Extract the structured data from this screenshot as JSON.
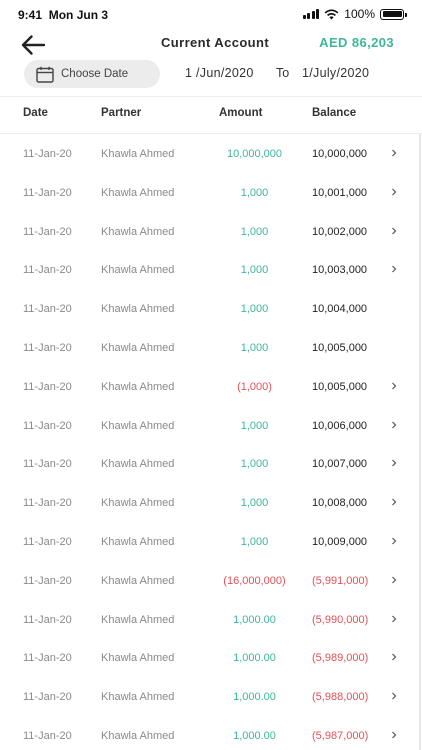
{
  "status_bar": {
    "time": "9:41",
    "date": "Mon Jun 3",
    "battery": "100%"
  },
  "header": {
    "title": "Current Account",
    "balance": "AED 86,203"
  },
  "filter": {
    "choose_label": "Choose Date",
    "from": "1 /Jun/2020",
    "to_word": "To",
    "to": "1/July/2020"
  },
  "table": {
    "columns": [
      "Date",
      "Partner",
      "Amount",
      "Balance"
    ],
    "rows": [
      {
        "date": "11-Jan-20",
        "partner": "Khawla Ahmed",
        "amount": "10,000,000",
        "amount_type": "pos",
        "balance": "10,000,000",
        "balance_type": "normal",
        "chevron": true
      },
      {
        "date": "11-Jan-20",
        "partner": "Khawla Ahmed",
        "amount": "1,000",
        "amount_type": "pos",
        "balance": "10,001,000",
        "balance_type": "normal",
        "chevron": true
      },
      {
        "date": "11-Jan-20",
        "partner": "Khawla Ahmed",
        "amount": "1,000",
        "amount_type": "pos",
        "balance": "10,002,000",
        "balance_type": "normal",
        "chevron": true
      },
      {
        "date": "11-Jan-20",
        "partner": "Khawla Ahmed",
        "amount": "1,000",
        "amount_type": "pos",
        "balance": "10,003,000",
        "balance_type": "normal",
        "chevron": true
      },
      {
        "date": "11-Jan-20",
        "partner": "Khawla Ahmed",
        "amount": "1,000",
        "amount_type": "pos",
        "balance": "10,004,000",
        "balance_type": "normal",
        "chevron": false
      },
      {
        "date": "11-Jan-20",
        "partner": "Khawla Ahmed",
        "amount": "1,000",
        "amount_type": "pos",
        "balance": "10,005,000",
        "balance_type": "normal",
        "chevron": false
      },
      {
        "date": "11-Jan-20",
        "partner": "Khawla Ahmed",
        "amount": "(1,000)",
        "amount_type": "neg",
        "balance": "10,005,000",
        "balance_type": "normal",
        "chevron": true
      },
      {
        "date": "11-Jan-20",
        "partner": "Khawla Ahmed",
        "amount": "1,000",
        "amount_type": "pos",
        "balance": "10,006,000",
        "balance_type": "normal",
        "chevron": true
      },
      {
        "date": "11-Jan-20",
        "partner": "Khawla Ahmed",
        "amount": "1,000",
        "amount_type": "pos",
        "balance": "10,007,000",
        "balance_type": "normal",
        "chevron": true
      },
      {
        "date": "11-Jan-20",
        "partner": "Khawla Ahmed",
        "amount": "1,000",
        "amount_type": "pos",
        "balance": "10,008,000",
        "balance_type": "normal",
        "chevron": true
      },
      {
        "date": "11-Jan-20",
        "partner": "Khawla Ahmed",
        "amount": "1,000",
        "amount_type": "pos",
        "balance": "10,009,000",
        "balance_type": "normal",
        "chevron": true
      },
      {
        "date": "11-Jan-20",
        "partner": "Khawla Ahmed",
        "amount": "(16,000,000)",
        "amount_type": "neg",
        "balance": "(5,991,000)",
        "balance_type": "neg",
        "chevron": true
      },
      {
        "date": "11-Jan-20",
        "partner": "Khawla Ahmed",
        "amount": "1,000.00",
        "amount_type": "pos",
        "balance": "(5,990,000)",
        "balance_type": "neg",
        "chevron": true
      },
      {
        "date": "11-Jan-20",
        "partner": "Khawla Ahmed",
        "amount": "1,000.00",
        "amount_type": "pos",
        "balance": "(5,989,000)",
        "balance_type": "neg",
        "chevron": true
      },
      {
        "date": "11-Jan-20",
        "partner": "Khawla Ahmed",
        "amount": "1,000.00",
        "amount_type": "pos",
        "balance": "(5,988,000)",
        "balance_type": "neg",
        "chevron": true
      },
      {
        "date": "11-Jan-20",
        "partner": "Khawla Ahmed",
        "amount": "1,000.00",
        "amount_type": "pos",
        "balance": "(5,987,000)",
        "balance_type": "neg",
        "chevron": true
      }
    ]
  },
  "colors": {
    "positive": "#3fb69b",
    "negative": "#e0525a",
    "muted": "#8a8a8a"
  },
  "icons": {
    "back": "arrow-left-icon",
    "calendar": "calendar-icon",
    "row": "chevron-right-icon"
  }
}
